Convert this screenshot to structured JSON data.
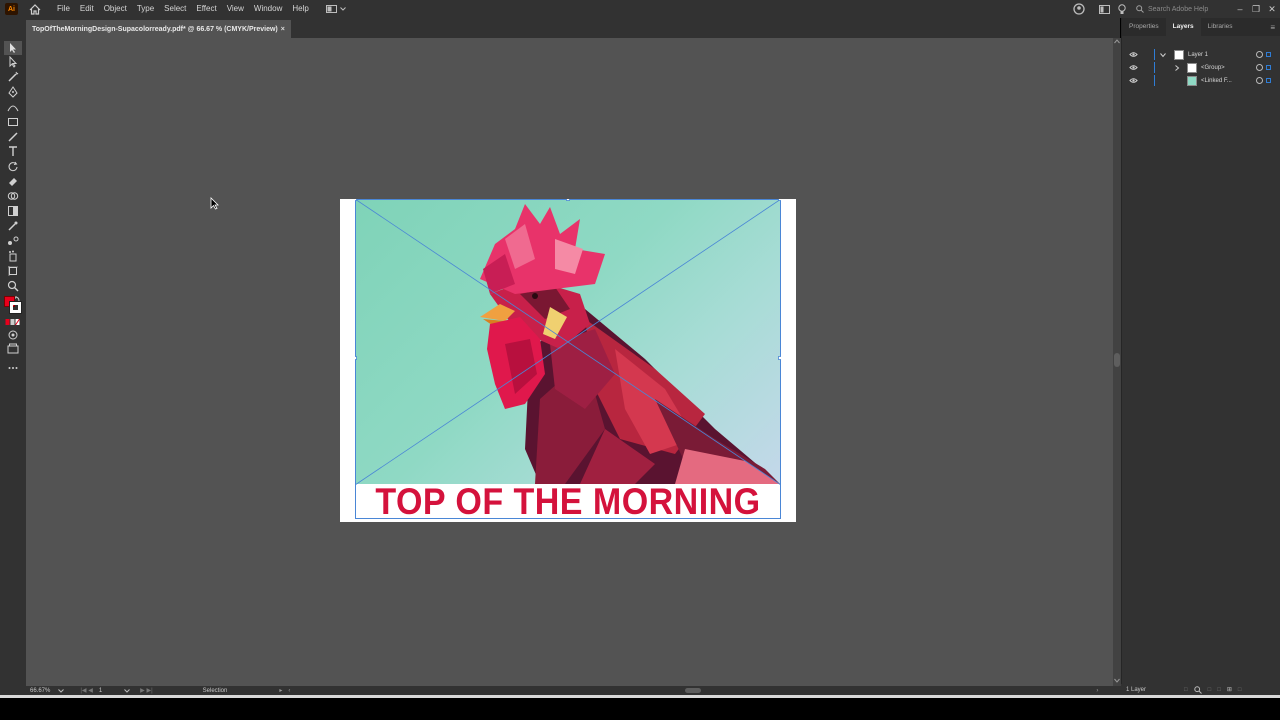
{
  "app": {
    "logo_text": "Ai",
    "menus": [
      "File",
      "Edit",
      "Object",
      "Type",
      "Select",
      "Effect",
      "View",
      "Window",
      "Help"
    ],
    "search_placeholder": "Search Adobe Help"
  },
  "document": {
    "tab_title": "TopOfTheMorningDesign-Supacolorready.pdf* @ 66.67 % (CMYK/Preview)",
    "close_glyph": "×"
  },
  "artwork": {
    "headline": "TOP OF THE MORNING",
    "headline_color": "#d4123c"
  },
  "tools": {
    "fill_color": "#e8001c",
    "stroke_color": "#ffffff"
  },
  "panel": {
    "tabs": [
      "Properties",
      "Layers",
      "Libraries"
    ],
    "active_tab": "Layers",
    "layers": [
      {
        "name": "Layer 1",
        "expanded": true
      },
      {
        "name": "<Group>",
        "expanded": false
      },
      {
        "name": "<Linked F..."
      }
    ],
    "layer_count": "1 Layer"
  },
  "status": {
    "zoom": "66.67%",
    "artboard": "1",
    "tool": "Selection"
  }
}
